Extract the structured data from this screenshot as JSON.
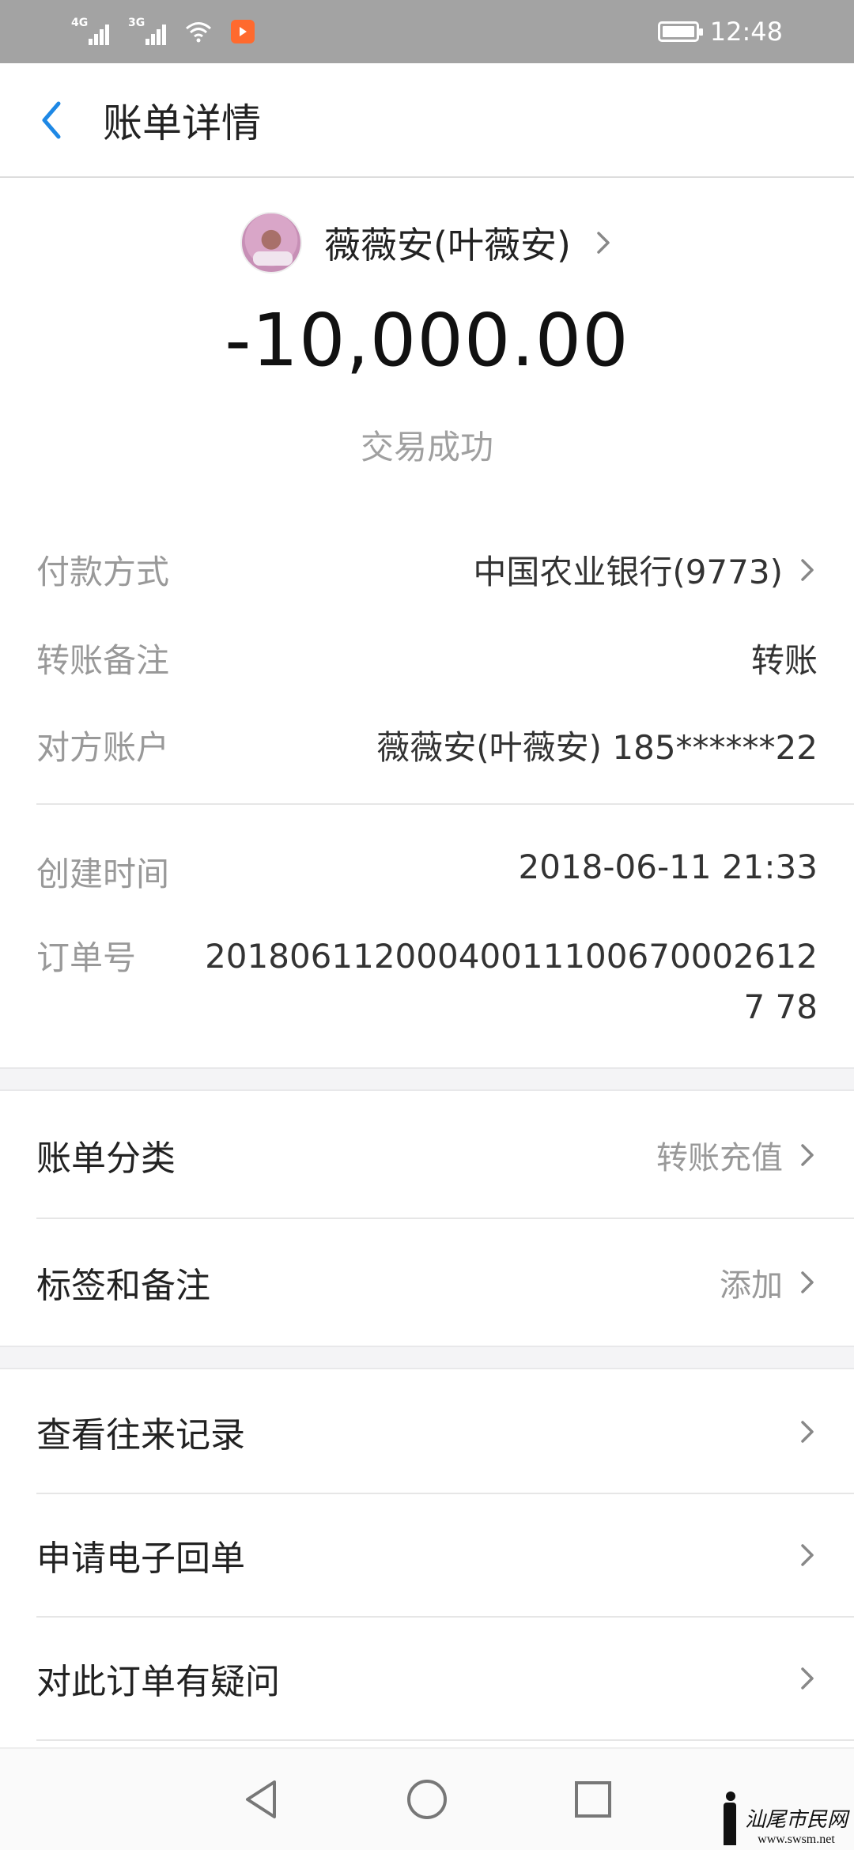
{
  "status_bar": {
    "net1": "4G",
    "net2": "3G",
    "time": "12:48"
  },
  "header": {
    "title": "账单详情"
  },
  "summary": {
    "payee_name": "薇薇安(叶薇安)",
    "amount": "-10,000.00",
    "status": "交易成功"
  },
  "details": {
    "payment_method_label": "付款方式",
    "payment_method_value": "中国农业银行(9773)",
    "remark_label": "转账备注",
    "remark_value": "转账",
    "counterparty_label": "对方账户",
    "counterparty_value": "薇薇安(叶薇安) 185******22",
    "created_label": "创建时间",
    "created_value": "2018-06-11 21:33",
    "order_label": "订单号",
    "order_value": "201806112000400111006700026127 78"
  },
  "options": {
    "category_label": "账单分类",
    "category_value": "转账充值",
    "tags_label": "标签和备注",
    "tags_value": "添加"
  },
  "actions": {
    "history": "查看往来记录",
    "receipt": "申请电子回单",
    "question": "对此订单有疑问"
  },
  "watermark": {
    "text": "汕尾市民网",
    "url": "www.swsm.net"
  },
  "colors": {
    "accent": "#1e88e5",
    "status_bar": "#a3a3a3",
    "muted": "#999999"
  }
}
